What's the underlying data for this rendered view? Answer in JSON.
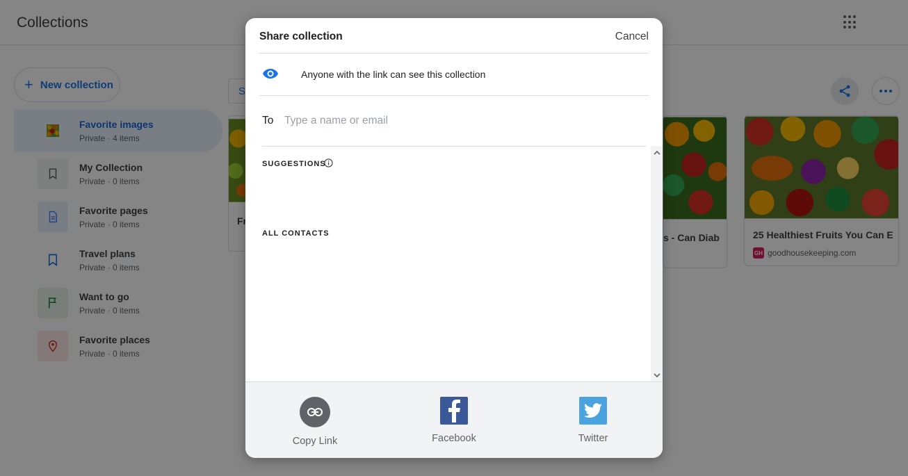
{
  "app": {
    "title": "Collections"
  },
  "sidebar": {
    "new_collection_label": "New collection",
    "items": [
      {
        "title": "Favorite images",
        "subtitle": "Private · 4 items",
        "icon": "fruit-thumbnail"
      },
      {
        "title": "My Collection",
        "subtitle": "Private · 0 items",
        "icon": "bookmark-icon"
      },
      {
        "title": "Favorite pages",
        "subtitle": "Private · 0 items",
        "icon": "document-icon"
      },
      {
        "title": "Travel plans",
        "subtitle": "Private · 0 items",
        "icon": "bookmark-icon"
      },
      {
        "title": "Want to go",
        "subtitle": "Private · 0 items",
        "icon": "flag-icon"
      },
      {
        "title": "Favorite places",
        "subtitle": "Private · 0 items",
        "icon": "location-pin-icon"
      }
    ]
  },
  "cards": [
    {
      "title": "Fr",
      "source": ""
    },
    {
      "title": "s - Can Diab",
      "source": ""
    },
    {
      "title": "25 Healthiest Fruits You Can E",
      "source": "goodhousekeeping.com",
      "source_logo": "GH"
    }
  ],
  "dialog": {
    "title": "Share collection",
    "cancel_label": "Cancel",
    "visibility_text": "Anyone with the link can see this collection",
    "to_label": "To",
    "to_placeholder": "Type a name or email",
    "suggestions_label": "SUGGESTIONS",
    "all_contacts_label": "ALL CONTACTS",
    "share_options": [
      {
        "label": "Copy Link",
        "icon": "link-icon"
      },
      {
        "label": "Facebook",
        "icon": "facebook-icon"
      },
      {
        "label": "Twitter",
        "icon": "twitter-icon"
      }
    ]
  },
  "colors": {
    "accent": "#1a73e8",
    "facebook": "#3b5998",
    "twitter": "#4aa3df",
    "overlay": "#000000"
  }
}
